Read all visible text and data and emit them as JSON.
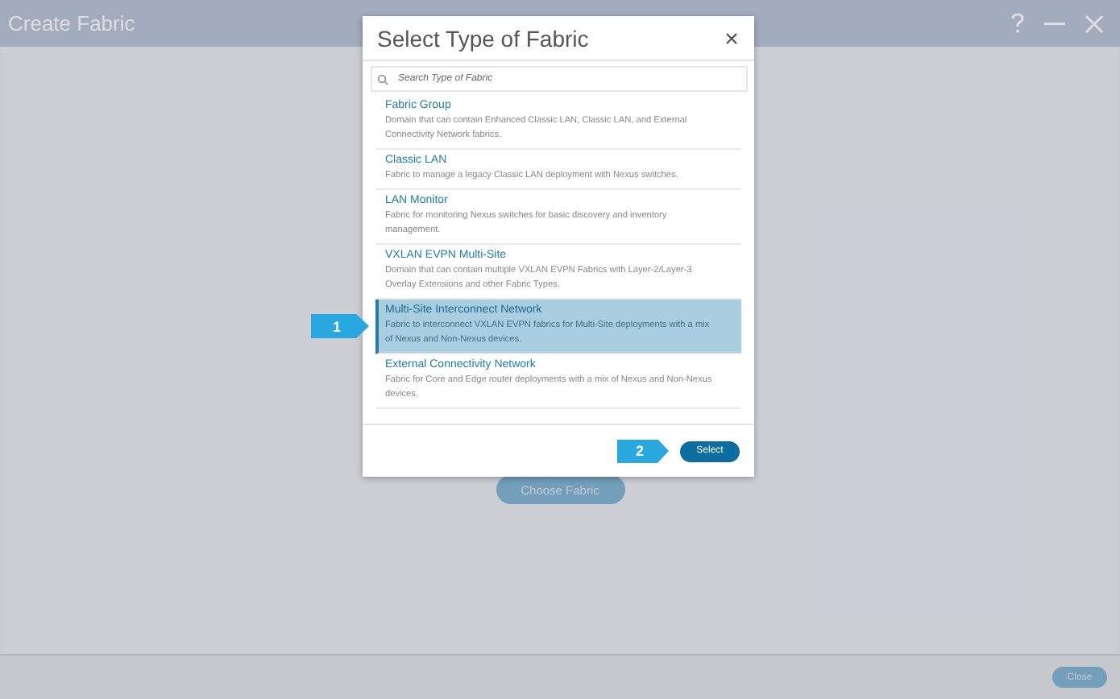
{
  "window": {
    "title": "Create Fabric"
  },
  "main": {
    "choose_button": "Choose Fabric"
  },
  "footer": {
    "close_button": "Close"
  },
  "dialog": {
    "title": "Select Type of Fabric",
    "search": {
      "placeholder": "Search Type of Fabric"
    },
    "items": [
      {
        "name": "Fabric Group",
        "description": "Domain that can contain Enhanced Classic LAN, Classic LAN, and External Connectivity Network fabrics.",
        "selected": false
      },
      {
        "name": "Classic LAN",
        "description": "Fabric to manage a legacy Classic LAN deployment with Nexus switches.",
        "selected": false
      },
      {
        "name": "LAN Monitor",
        "description": "Fabric for monitoring Nexus switches for basic discovery and inventory management.",
        "selected": false
      },
      {
        "name": "VXLAN EVPN Multi-Site",
        "description": "Domain that can contain multiple VXLAN EVPN Fabrics with Layer-2/Layer-3 Overlay Extensions and other Fabric Types.",
        "selected": false
      },
      {
        "name": "Multi-Site Interconnect Network",
        "description": "Fabric to interconnect VXLAN EVPN fabrics for Multi-Site deployments with a mix of Nexus and Non-Nexus devices.",
        "selected": true,
        "callout": "1"
      },
      {
        "name": "External Connectivity Network",
        "description": "Fabric for Core and Edge router deployments with a mix of Nexus and Non-Nexus devices.",
        "selected": false
      }
    ],
    "footer_callout": "2",
    "select_button": "Select"
  }
}
